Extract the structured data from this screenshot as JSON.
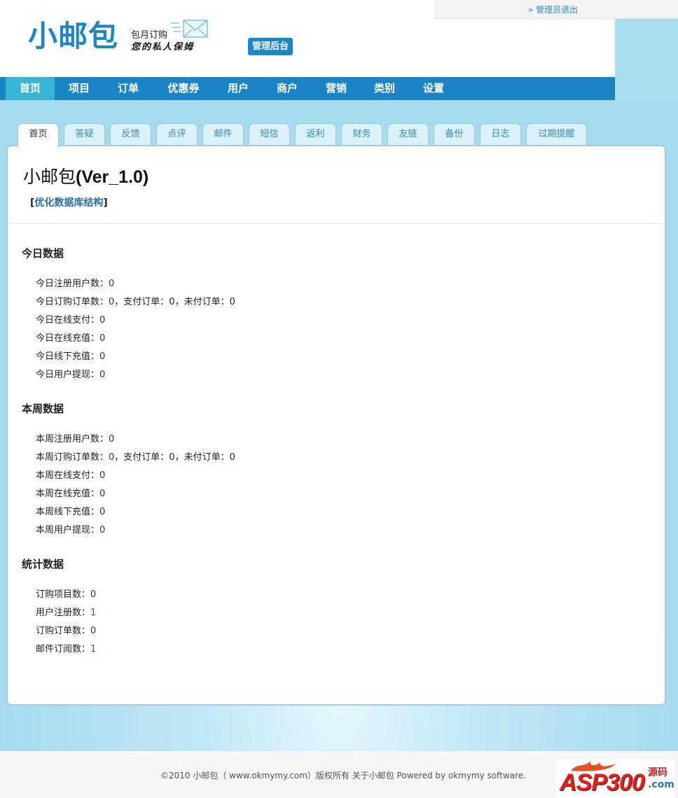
{
  "header": {
    "logout_link": "» 管理员退出",
    "logo_title": "小邮包",
    "logo_sub1": "包月订购",
    "logo_sub2": "您的私人保姆",
    "admin_badge": "管理后台"
  },
  "main_nav": [
    {
      "label": "首页",
      "active": true
    },
    {
      "label": "项目"
    },
    {
      "label": "订单"
    },
    {
      "label": "优惠券"
    },
    {
      "label": "用户"
    },
    {
      "label": "商户"
    },
    {
      "label": "营销"
    },
    {
      "label": "类别"
    },
    {
      "label": "设置"
    }
  ],
  "sub_tabs": [
    "首页",
    "答疑",
    "反馈",
    "点评",
    "邮件",
    "短信",
    "返利",
    "财务",
    "友链",
    "备份",
    "日志",
    "过期提醒"
  ],
  "panel": {
    "title_prefix": "小邮包",
    "title_version": "(Ver_1.0)",
    "optimize_open": "[",
    "optimize_link": "优化数据库结构",
    "optimize_close": "]"
  },
  "sections": [
    {
      "title": "今日数据",
      "rows": [
        {
          "label": "今日注册用户数：",
          "value": "0"
        },
        {
          "label": "今日订购订单数：",
          "value": "0",
          "rest": "，支付订单：0，未付订单：0"
        },
        {
          "label": "今日在线支付：",
          "value": "0"
        },
        {
          "label": "今日在线充值：",
          "value": "0"
        },
        {
          "label": "今日线下充值：",
          "value": "0"
        },
        {
          "label": "今日用户提现：",
          "value": "0"
        }
      ]
    },
    {
      "title": "本周数据",
      "rows": [
        {
          "label": "本周注册用户数：",
          "value": "0"
        },
        {
          "label": "本周订购订单数：",
          "value": "0",
          "rest": "，支付订单：0，未付订单：0"
        },
        {
          "label": "本周在线支付：",
          "value": "0"
        },
        {
          "label": "本周在线充值：",
          "value": "0"
        },
        {
          "label": "本周线下充值：",
          "value": "0"
        },
        {
          "label": "本周用户提现：",
          "value": "0"
        }
      ]
    },
    {
      "title": "统计数据",
      "rows": [
        {
          "label": "订购项目数：",
          "value": "0"
        },
        {
          "label": "用户注册数：",
          "value": "1",
          "green": true
        },
        {
          "label": "订购订单数：",
          "value": "0"
        },
        {
          "label": "邮件订阅数：",
          "value": "1",
          "green": true
        }
      ]
    }
  ],
  "footer": {
    "text": "©2010 小邮包（ www.okmymy.com）版权所有 关于小邮包  Powered by okmymy software."
  },
  "watermark": {
    "asp": "ASP300",
    "yuanma": "源码",
    "com": ".com"
  },
  "colors": {
    "brand_blue": "#1a84c4",
    "active_nav": "#36b6d4",
    "page_bg": "#a9ddf0"
  }
}
